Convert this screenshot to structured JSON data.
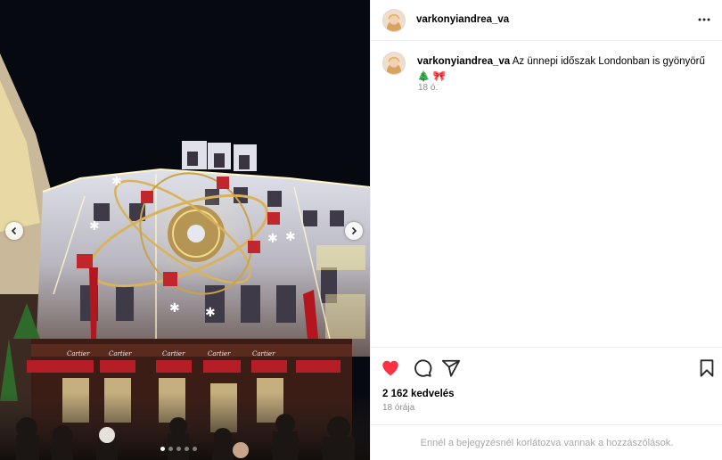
{
  "post": {
    "username": "varkonyiandrea_va",
    "caption": {
      "username": "varkonyiandrea_va",
      "text": " Az ünnepi időszak Londonban is gyönyörű 🎄 🎀",
      "time": "18 ó."
    },
    "likes": "2 162 kedvelés",
    "time_ago": "18 órája",
    "comments_disabled": "Ennél a bejegyzésnél korlátozva vannak a hozzászólások.",
    "carousel": {
      "slide_count": 5,
      "active_slide": 1
    }
  },
  "colors": {
    "like_red": "#ff3040",
    "muted_text": "#8e8e8e",
    "divider": "#efefef"
  },
  "icons": {
    "like": "heart-filled-icon",
    "comment": "comment-bubble-icon",
    "share": "paper-plane-icon",
    "save": "bookmark-icon",
    "more": "more-dots-icon",
    "prev": "chevron-left-icon",
    "next": "chevron-right-icon"
  }
}
